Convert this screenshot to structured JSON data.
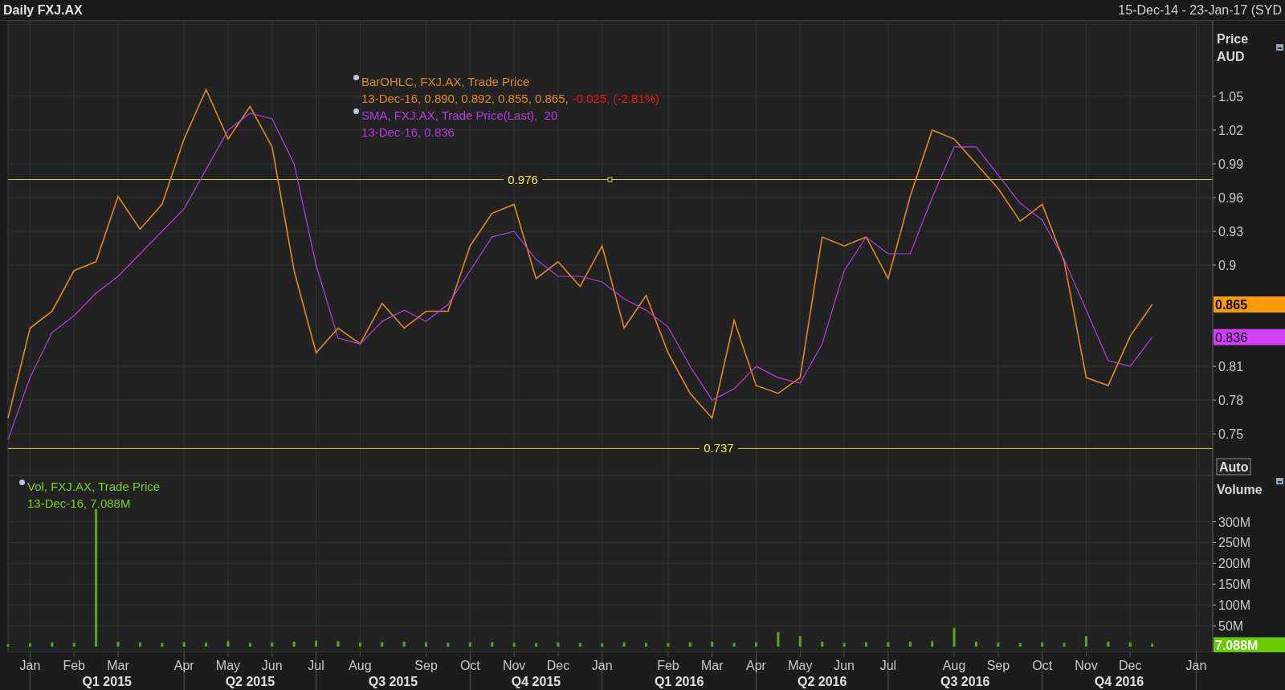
{
  "header": {
    "title": "Daily FXJ.AX",
    "range": "15-Dec-14 - 23-Jan-17 (SYD"
  },
  "price_panel": {
    "axis_title": "Price",
    "currency": "AUD",
    "auto_button": "Auto",
    "legend": [
      {
        "kind": "bars",
        "values": "13-Dec-16, 0.890, 0.892, 0.855, 0.865,",
        "change": "-0.025, (-2.81%)"
      },
      {
        "kind": "line",
        "values": "13-Dec-16, 0.836"
      }
    ],
    "tags": [
      {
        "label": "0.865",
        "color": "#ff9900"
      },
      {
        "label": "0.836",
        "color": "#d040f8"
      }
    ],
    "chart_data": {
      "type": "line",
      "categories": [
        null,
        null,
        null,
        null,
        null,
        null,
        null,
        null,
        null,
        null,
        null,
        null,
        null,
        null,
        null,
        null,
        null,
        null,
        null,
        null,
        null,
        null,
        null,
        null,
        null,
        null,
        null,
        null,
        null,
        null,
        null,
        null,
        null,
        null,
        null,
        null,
        null,
        null,
        null,
        null,
        null,
        null,
        null,
        null,
        null,
        null,
        null,
        null,
        null,
        null,
        null,
        null,
        null,
        null,
        null
      ],
      "series": [
        {
          "name": "BarOHLC, FXJ.AX, Trade Price",
          "color": "#e08a1e",
          "values": [
            0.764,
            0.844,
            0.859,
            0.895,
            0.903,
            0.961,
            0.932,
            0.954,
            1.012,
            1.056,
            1.012,
            1.041,
            1.005,
            0.895,
            0.822,
            0.844,
            0.83,
            0.866,
            0.844,
            0.859,
            0.859,
            0.917,
            0.946,
            0.954,
            0.888,
            0.903,
            0.881,
            0.917,
            0.844,
            0.873,
            0.822,
            0.786,
            0.764,
            0.851,
            0.793,
            0.786,
            0.8,
            0.925,
            0.917,
            0.925,
            0.888,
            0.961,
            1.02,
            1.012,
            0.99,
            0.968,
            0.939,
            0.954,
            0.903,
            0.8,
            0.793,
            0.837,
            0.865,
            null,
            null
          ]
        },
        {
          "name": "SMA, FXJ.AX, Trade Price(Last),  20",
          "color": "#b040e0",
          "values": [
            0.745,
            0.8,
            0.84,
            0.855,
            0.875,
            0.89,
            0.91,
            0.93,
            0.95,
            0.985,
            1.02,
            1.035,
            1.03,
            0.99,
            0.9,
            0.835,
            0.83,
            0.85,
            0.86,
            0.85,
            0.865,
            0.895,
            0.925,
            0.93,
            0.905,
            0.89,
            0.89,
            0.885,
            0.87,
            0.86,
            0.845,
            0.81,
            0.78,
            0.79,
            0.81,
            0.8,
            0.795,
            0.83,
            0.895,
            0.925,
            0.91,
            0.91,
            0.96,
            1.005,
            1.005,
            0.98,
            0.955,
            0.94,
            0.905,
            0.86,
            0.815,
            0.81,
            0.836,
            null,
            null
          ]
        }
      ],
      "ylim": [
        0.713,
        1.117
      ],
      "yticks": [
        {
          "value": 0.75,
          "label": "0.75"
        },
        {
          "value": 0.78,
          "label": "0.78"
        },
        {
          "value": 0.81,
          "label": "0.81"
        },
        {
          "value": 0.9,
          "label": "0.9"
        },
        {
          "value": 0.93,
          "label": "0.93"
        },
        {
          "value": 0.96,
          "label": "0.96"
        },
        {
          "value": 0.99,
          "label": "0.99"
        },
        {
          "value": 1.02,
          "label": "1.02"
        },
        {
          "value": 1.05,
          "label": "1.05"
        }
      ],
      "grid": true,
      "ref_lines": [
        {
          "axis": "y",
          "value": 0.976,
          "label": "0.976"
        },
        {
          "axis": "y",
          "value": 0.737,
          "label": "0.737"
        }
      ]
    }
  },
  "volume_panel": {
    "axis_title": "Volume",
    "legend": {
      "values": "13-Dec-16, 7.088M"
    },
    "tag": {
      "label": "7.088M"
    },
    "chart_data": {
      "type": "bar",
      "categories": [
        null,
        "Jan",
        null,
        "Feb",
        null,
        "Mar",
        null,
        null,
        "Apr",
        null,
        "May",
        null,
        "Jun",
        null,
        "Jul",
        null,
        "Aug",
        null,
        null,
        "Sep",
        null,
        "Oct",
        null,
        "Nov",
        null,
        "Dec",
        null,
        "Jan",
        null,
        null,
        "Feb",
        null,
        "Mar",
        null,
        "Apr",
        null,
        "May",
        null,
        "Jun",
        null,
        "Jul",
        null,
        null,
        "Aug",
        null,
        "Sep",
        null,
        "Oct",
        null,
        "Nov",
        null,
        "Dec",
        null,
        null,
        "Jan"
      ],
      "series": [
        {
          "name": "Vol, FXJ.AX, Trade Price",
          "color": "#5ca81a",
          "values": [
            6,
            8,
            10,
            9,
            330,
            12,
            10,
            9,
            11,
            10,
            13,
            9,
            10,
            12,
            14,
            13,
            10,
            11,
            12,
            10,
            9,
            10,
            11,
            9,
            8,
            10,
            9,
            8,
            10,
            9,
            8,
            10,
            12,
            9,
            10,
            35,
            25,
            12,
            9,
            10,
            11,
            12,
            13,
            45,
            12,
            10,
            9,
            10,
            9,
            25,
            12,
            10,
            7,
            null,
            null
          ]
        }
      ],
      "ylim": [
        -13.5,
        411
      ],
      "grid": true,
      "yticks": [
        {
          "value": 50,
          "label": "50M"
        },
        {
          "value": 100,
          "label": "100M"
        },
        {
          "value": 150,
          "label": "150M"
        },
        {
          "value": 200,
          "label": "200M"
        },
        {
          "value": 250,
          "label": "250M"
        },
        {
          "value": 300,
          "label": "300M"
        }
      ]
    }
  },
  "time_axis": {
    "quarters": [
      "Q1 2015",
      "Q2 2015",
      "Q3 2015",
      "Q4 2015",
      "Q1 2016",
      "Q2 2016",
      "Q3 2016",
      "Q4 2016"
    ]
  }
}
